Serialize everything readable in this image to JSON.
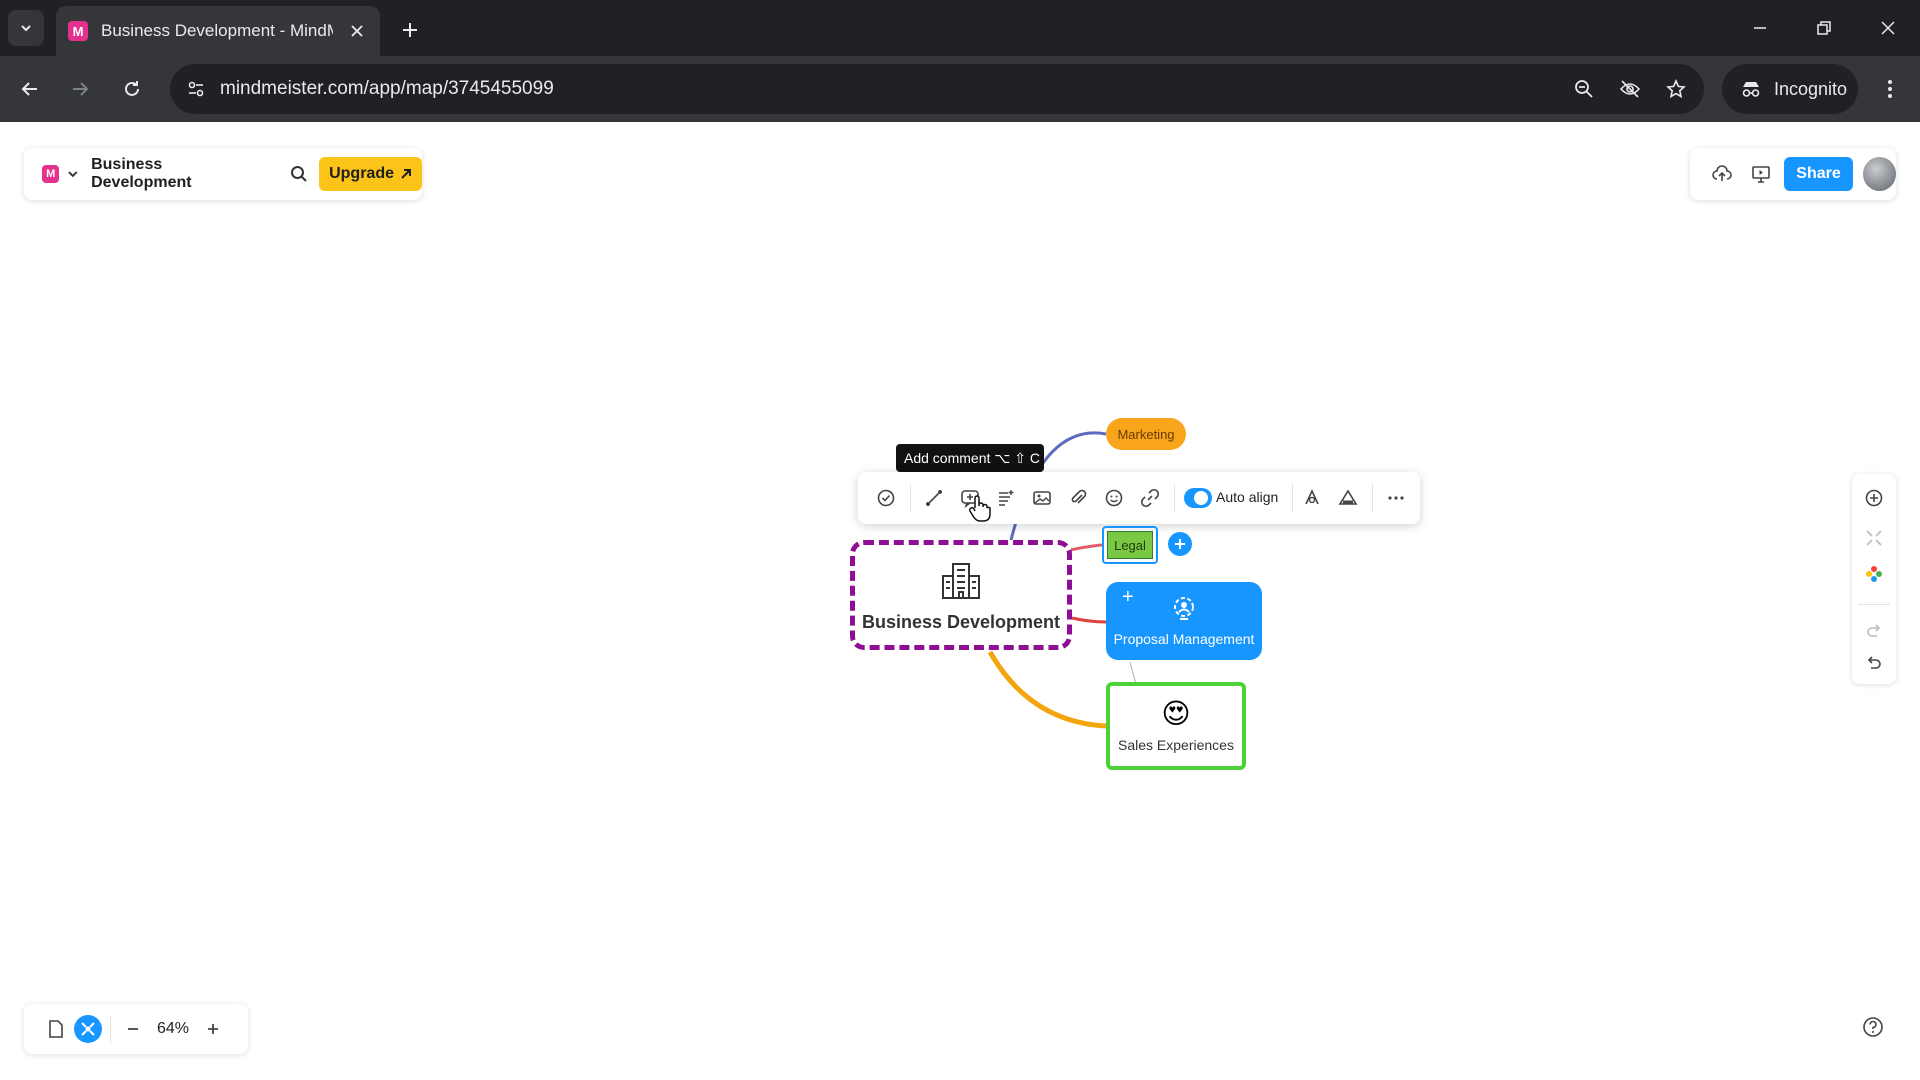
{
  "browser": {
    "tab_title": "Business Development - MindM",
    "tab_favicon": "M",
    "url": "mindmeister.com/app/map/3745455099",
    "incognito_label": "Incognito"
  },
  "app": {
    "logo": "M",
    "map_name": "Business Development",
    "upgrade_label": "Upgrade",
    "share_label": "Share"
  },
  "node_toolbar": {
    "tooltip": "Add comment ⌥ ⇧ C",
    "auto_align_label": "Auto align",
    "auto_align_on": true
  },
  "map": {
    "root": {
      "label": "Business Development",
      "icon": "office-building-icon",
      "border_color": "#8e0f93"
    },
    "children": [
      {
        "label": "Marketing",
        "color": "#f8a51c"
      },
      {
        "label": "Legal",
        "color": "#7ac943"
      },
      {
        "label": "Proposal Management",
        "color": "#1896ff",
        "icon": "settings-person-icon"
      },
      {
        "label": "Sales Experiences",
        "color": "#4cd137",
        "emoji": "😍"
      }
    ]
  },
  "zoom": {
    "level": "64%"
  },
  "colors": {
    "accent": "#1896ff",
    "upgrade": "#fcc419",
    "brand": "#e5318e"
  }
}
